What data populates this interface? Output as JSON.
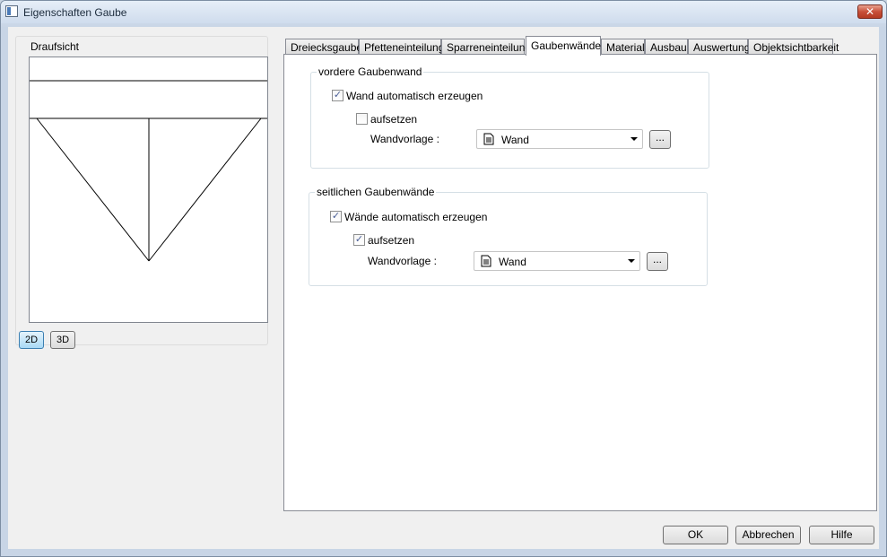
{
  "window": {
    "title": "Eigenschaften Gaube",
    "close_label": "✕"
  },
  "draufsicht": {
    "label": "Draufsicht",
    "buttons": {
      "view_2d": "2D",
      "view_3d": "3D"
    },
    "active_view": "2D"
  },
  "tabs": [
    {
      "label": "Dreiecksgaube"
    },
    {
      "label": "Pfetteneinteilung"
    },
    {
      "label": "Sparreneinteilung"
    },
    {
      "label": "Gaubenwände"
    },
    {
      "label": "Material"
    },
    {
      "label": "Ausbau"
    },
    {
      "label": "Auswertung"
    },
    {
      "label": "Objektsichtbarkeit"
    }
  ],
  "selected_tab": "Gaubenwände",
  "front_wall": {
    "title": "vordere Gaubenwand",
    "auto_create_label": "Wand automatisch erzeugen",
    "auto_create_checked": true,
    "set_on_label": "aufsetzen",
    "set_on_checked": false,
    "template_label": "Wandvorlage :",
    "template_value": "Wand",
    "browse_label": "..."
  },
  "side_walls": {
    "title": "seitlichen Gaubenwände",
    "auto_create_label": "Wände automatisch erzeugen",
    "auto_create_checked": true,
    "set_on_label": "aufsetzen",
    "set_on_checked": true,
    "template_label": "Wandvorlage :",
    "template_value": "Wand",
    "browse_label": "..."
  },
  "footer": {
    "ok": "OK",
    "cancel": "Abbrechen",
    "help": "Hilfe"
  }
}
